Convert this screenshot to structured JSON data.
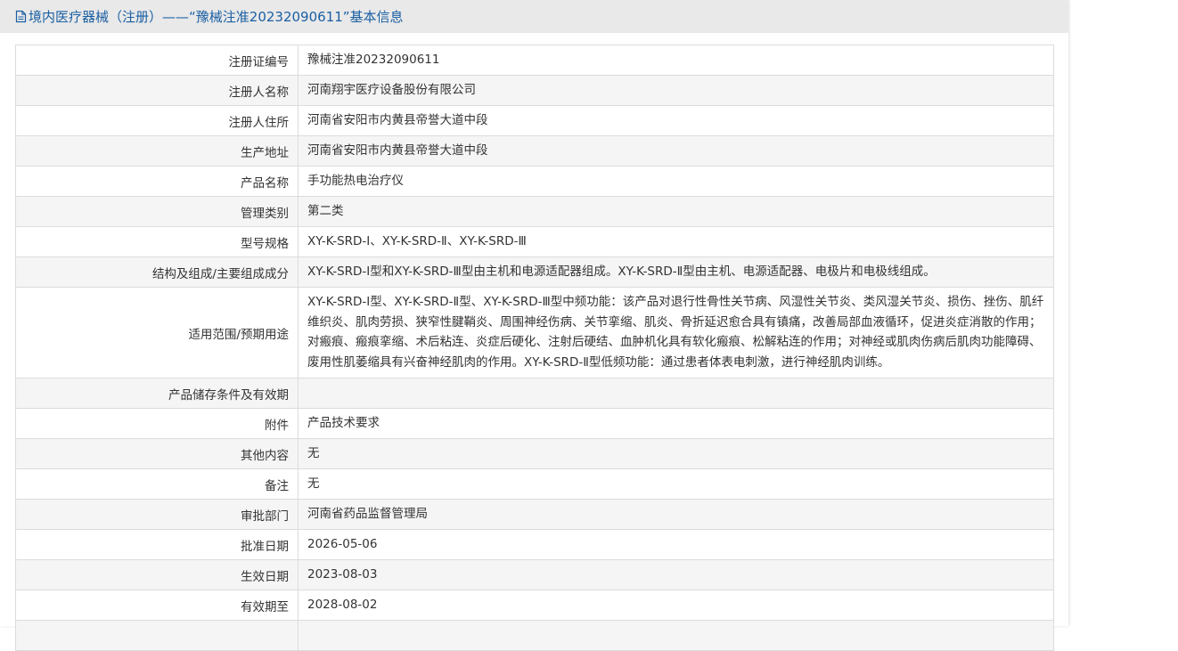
{
  "header": {
    "title": "境内医疗器械（注册）——“豫械注准20232090611”基本信息"
  },
  "rows": [
    {
      "label": "注册证编号",
      "value": "豫械注准20232090611"
    },
    {
      "label": "注册人名称",
      "value": "河南翔宇医疗设备股份有限公司"
    },
    {
      "label": "注册人住所",
      "value": "河南省安阳市内黄县帝誉大道中段"
    },
    {
      "label": "生产地址",
      "value": "河南省安阳市内黄县帝誉大道中段"
    },
    {
      "label": "产品名称",
      "value": "手功能热电治疗仪"
    },
    {
      "label": "管理类别",
      "value": "第二类"
    },
    {
      "label": "型号规格",
      "value": "XY-K-SRD-Ⅰ、XY-K-SRD-Ⅱ、XY-K-SRD-Ⅲ"
    },
    {
      "label": "结构及组成/主要组成成分",
      "value": "XY-K-SRD-Ⅰ型和XY-K-SRD-Ⅲ型由主机和电源适配器组成。XY-K-SRD-Ⅱ型由主机、电源适配器、电极片和电极线组成。"
    },
    {
      "label": "适用范围/预期用途",
      "value": "XY-K-SRD-Ⅰ型、XY-K-SRD-Ⅱ型、XY-K-SRD-Ⅲ型中频功能：该产品对退行性骨性关节病、风湿性关节炎、类风湿关节炎、损伤、挫伤、肌纤维织炎、肌肉劳损、狭窄性腱鞘炎、周围神经伤病、关节挛缩、肌炎、骨折延迟愈合具有镇痛，改善局部血液循环，促进炎症消散的作用；对瘢痕、瘢痕挛缩、术后粘连、炎症后硬化、注射后硬结、血肿机化具有软化瘢痕、松解粘连的作用；对神经或肌肉伤病后肌肉功能障碍、废用性肌萎缩具有兴奋神经肌肉的作用。XY-K-SRD-Ⅱ型低频功能：通过患者体表电刺激，进行神经肌肉训练。"
    },
    {
      "label": "产品储存条件及有效期",
      "value": ""
    },
    {
      "label": "附件",
      "value": "产品技术要求"
    },
    {
      "label": "其他内容",
      "value": "无"
    },
    {
      "label": "备注",
      "value": "无"
    },
    {
      "label": "审批部门",
      "value": "河南省药品监督管理局"
    },
    {
      "label": "批准日期",
      "value": "2026-05-06"
    },
    {
      "label": "生效日期",
      "value": "2023-08-03"
    },
    {
      "label": "有效期至",
      "value": "2028-08-02"
    },
    {
      "label": "",
      "value": ""
    }
  ],
  "icons": {
    "header_icon": "document-icon"
  },
  "colors": {
    "title": "#1a5fa3",
    "header_bg": "#e9e9e9",
    "alt_row_bg": "#f5f5f5",
    "border": "#dcdcdc"
  }
}
